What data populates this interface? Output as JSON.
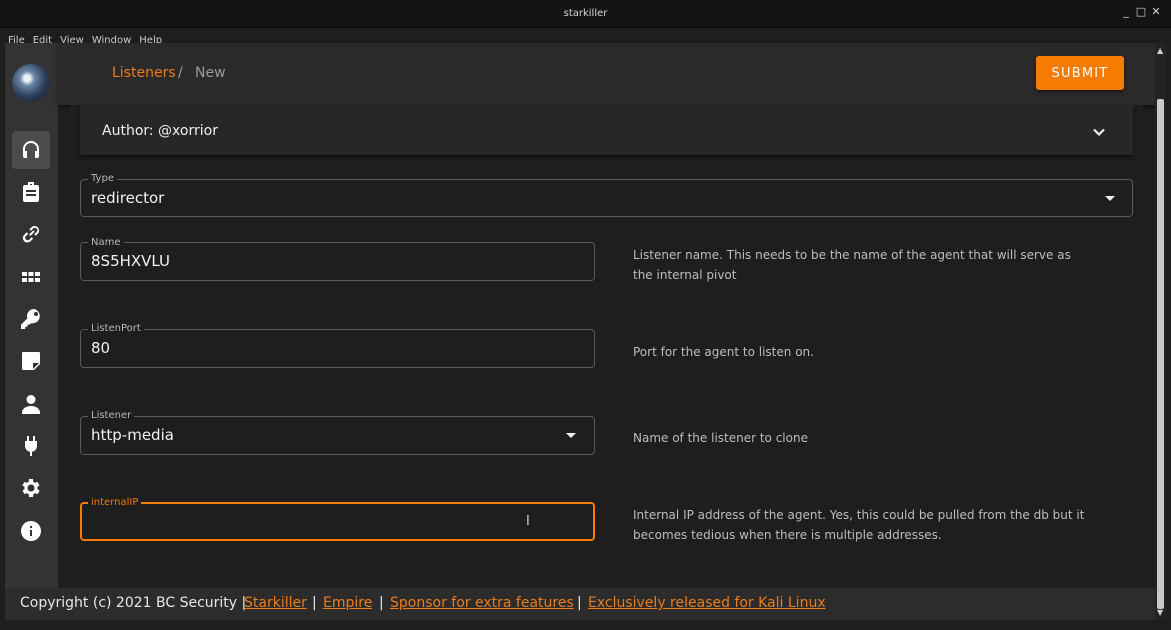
{
  "window": {
    "title": "starkiller",
    "minimize": "_",
    "maximize": "□",
    "close": "✕"
  },
  "menu": [
    "File",
    "Edit",
    "View",
    "Window",
    "Help"
  ],
  "sidebar": {
    "items": [
      {
        "icon": "headset-icon",
        "active": true
      },
      {
        "icon": "briefcase-icon",
        "active": false
      },
      {
        "icon": "link-icon",
        "active": false
      },
      {
        "icon": "apps-grid-icon",
        "active": false
      },
      {
        "icon": "key-icon",
        "active": false
      },
      {
        "icon": "note-icon",
        "active": false
      },
      {
        "icon": "user-icon",
        "active": false
      },
      {
        "icon": "plug-icon",
        "active": false
      },
      {
        "icon": "gear-icon",
        "active": false
      },
      {
        "icon": "info-icon",
        "active": false
      }
    ]
  },
  "header": {
    "breadcrumb_link": "Listeners",
    "breadcrumb_sep": "/",
    "breadcrumb_current": "New",
    "submit_label": "SUBMIT"
  },
  "author": {
    "text": "Author: @xorrior"
  },
  "form": {
    "type": {
      "label": "Type",
      "value": "redirector"
    },
    "name": {
      "label": "Name",
      "value": "8S5HXVLU",
      "hint": "Listener name. This needs to be the name of the agent that will serve as the internal pivot"
    },
    "listen_port": {
      "label": "ListenPort",
      "value": "80",
      "hint": "Port for the agent to listen on."
    },
    "listener": {
      "label": "Listener",
      "value": "http-media",
      "hint": "Name of the listener to clone"
    },
    "internal_ip": {
      "label": "internalIP",
      "value": "",
      "hint": "Internal IP address of the agent. Yes, this could be pulled from the db but it becomes tedious when there is multiple addresses."
    }
  },
  "footer": {
    "copyright": "Copyright (c) 2021 BC Security |",
    "sep": "|",
    "links": [
      "Starkiller",
      "Empire",
      "Sponsor for extra features",
      "Exclusively released for Kali Linux"
    ]
  },
  "colors": {
    "accent": "#f57c00",
    "sidebar": "#333333",
    "background": "#1e1e1e"
  }
}
